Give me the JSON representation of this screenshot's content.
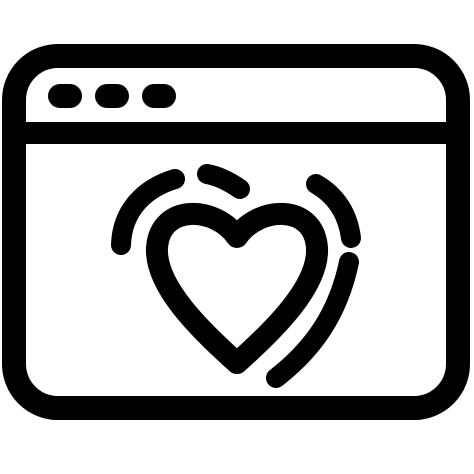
{
  "icon": {
    "name": "browser-heart-icon",
    "stroke_color": "#000000",
    "background_color": "#ffffff",
    "window": {
      "dots": [
        "dot-1",
        "dot-2",
        "dot-3"
      ]
    }
  }
}
